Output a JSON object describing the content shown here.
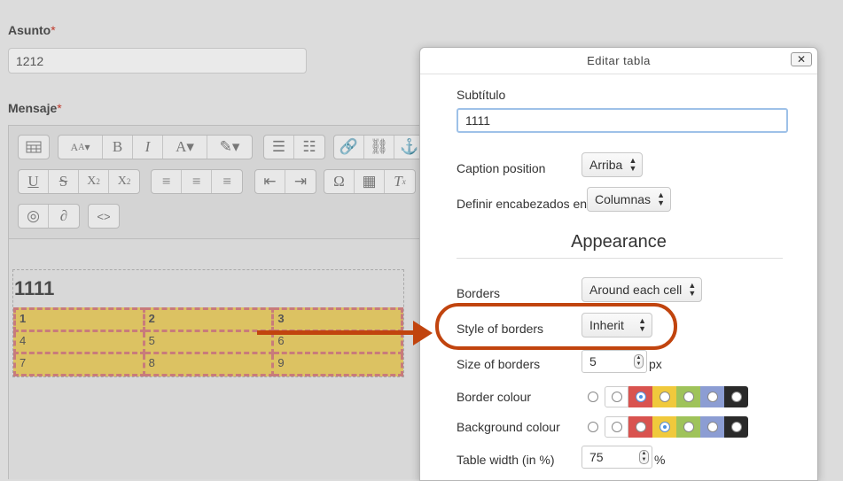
{
  "form": {
    "subject_label": "Asunto",
    "subject_value": "1212",
    "message_label": "Mensaje",
    "required_mark": "*"
  },
  "editor": {
    "caption": "1111",
    "rows": [
      [
        "1",
        "2",
        "3"
      ],
      [
        "4",
        "5",
        "6"
      ],
      [
        "7",
        "8",
        "9"
      ]
    ],
    "toolbar_icons": [
      "table-icon",
      "font-size-icon",
      "bold-icon",
      "italic-icon",
      "font-color-icon",
      "highlight-icon",
      "bullet-list-icon",
      "numbered-list-icon",
      "link-icon",
      "unlink-icon",
      "anchor-icon",
      "underline-icon",
      "strikethrough-icon",
      "subscript-icon",
      "superscript-icon",
      "align-left-icon",
      "align-center-icon",
      "align-right-icon",
      "outdent-icon",
      "indent-icon",
      "omega-icon",
      "table-grid-icon",
      "clear-format-icon",
      "visibility-icon",
      "hearing-icon",
      "code-icon"
    ],
    "toolbar_glyphs": {
      "bold": "B",
      "italic": "I",
      "underline": "U",
      "strike": "S",
      "omega": "Ω",
      "code": "<>"
    }
  },
  "dialog": {
    "title": "Editar tabla",
    "close": "✕",
    "subtitle_label": "Subtítulo",
    "subtitle_value": "1111",
    "caption_position_label": "Caption position",
    "caption_position_value": "Arriba",
    "headers_label": "Definir encabezados en",
    "headers_value": "Columnas",
    "appearance_heading": "Appearance",
    "borders_label": "Borders",
    "borders_value": "Around each cell",
    "style_label": "Style of borders",
    "style_value": "Inherit",
    "size_label": "Size of borders",
    "size_value": "5",
    "size_unit": "px",
    "border_colour_label": "Border colour",
    "background_colour_label": "Background colour",
    "width_label": "Table width (in %)",
    "width_value": "75",
    "width_unit": "%"
  },
  "colors": {
    "swatches": [
      "#ffffff",
      "#d9534f",
      "#f0c93c",
      "#9fc35a",
      "#8c9dd3",
      "#2a2a2a"
    ],
    "annotation": "#c1440e",
    "table_bg": "#dcc262",
    "table_border": "#c87b7b",
    "border_colour_selected": "#d9534f",
    "background_colour_selected": "#f0c93c"
  }
}
